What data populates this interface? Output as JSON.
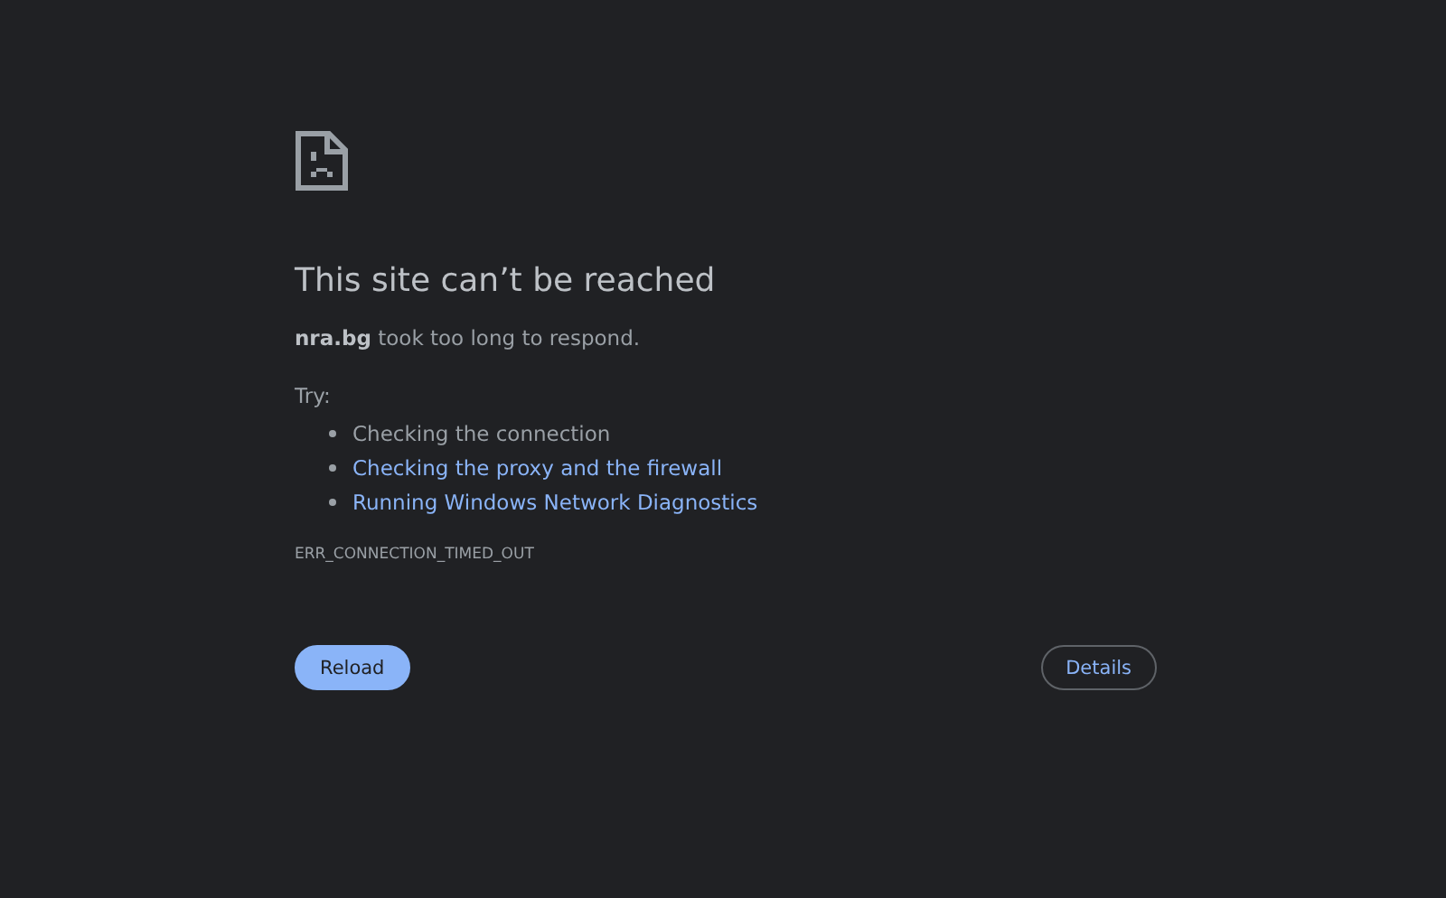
{
  "title": "This site can’t be reached",
  "message": "**nra.bg** took too long to respond.",
  "try_label": "Try:",
  "suggestions": [
    {
      "kind": "text",
      "text": "Checking the connection"
    },
    {
      "kind": "link",
      "text": "Checking the proxy and the firewall"
    },
    {
      "kind": "link",
      "text": "Running Windows Network Diagnostics"
    }
  ],
  "error_code": "ERR_CONNECTION_TIMED_OUT",
  "buttons": [
    {
      "kind": "primary",
      "label": "Reload"
    },
    {
      "kind": "outline",
      "label": "Details"
    }
  ]
}
